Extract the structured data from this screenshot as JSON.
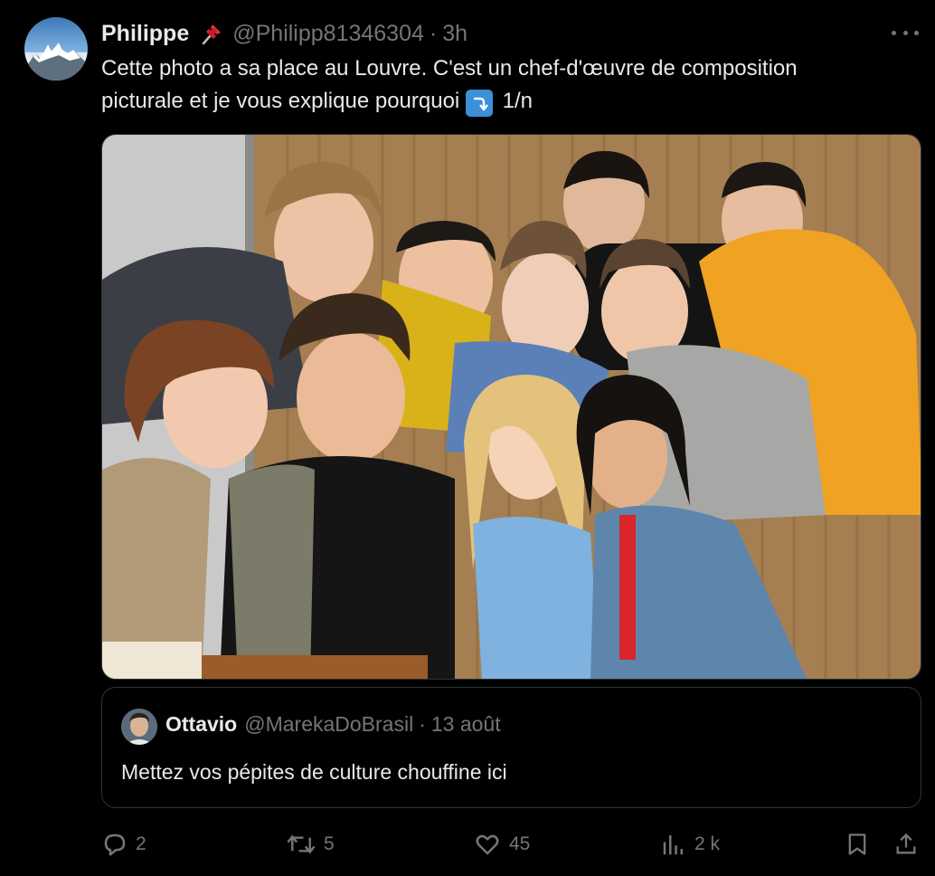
{
  "tweet": {
    "author_name": "Philippe",
    "pin_icon": "pushpin-icon",
    "handle": "@Philipp81346304",
    "separator": "·",
    "time": "3h",
    "text_line1": "Cette photo a sa place au Louvre. C'est un chef-d'œuvre de composition",
    "text_line2_before": "picturale et je vous explique pourquoi",
    "text_line2_after": "1/n",
    "media_alt_icon": "group-photo"
  },
  "quote": {
    "author_name": "Ottavio",
    "handle": "@MarekaDoBrasil",
    "separator": "·",
    "date": "13 août",
    "text": "Mettez vos pépites de culture chouffine ici"
  },
  "actions": {
    "reply_count": "2",
    "retweet_count": "5",
    "like_count": "45",
    "views_count": "2 k"
  },
  "colors": {
    "background": "#000000",
    "text_primary": "#e7e9ea",
    "text_secondary": "#71767b",
    "border": "#2f3336",
    "emoji_blue": "#3c8fd8"
  }
}
